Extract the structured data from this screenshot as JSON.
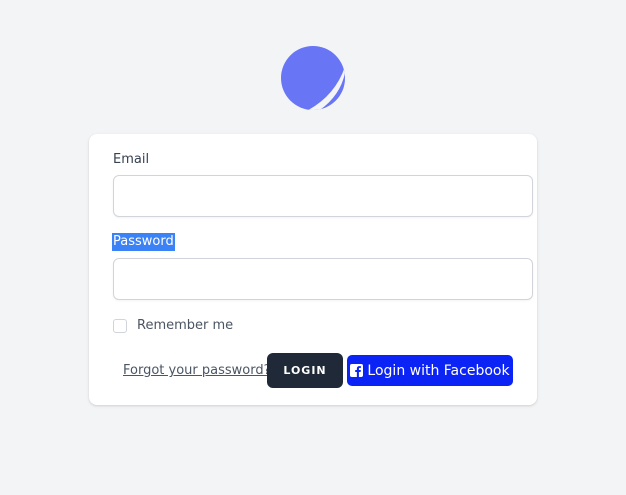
{
  "logo": {
    "icon": "app-logo-icon",
    "color": "#6875f5"
  },
  "form": {
    "email_label": "Email",
    "email_value": "",
    "password_label": "Password",
    "password_value": "",
    "remember_label": "Remember me",
    "remember_checked": false,
    "forgot_label": "Forgot your password?",
    "login_label": "LOGIN",
    "facebook_label": "Login with Facebook",
    "facebook_icon": "facebook-square-icon"
  },
  "colors": {
    "background": "#f3f4f6",
    "login_button": "#1f2937",
    "facebook_button": "#0b24f5",
    "selection_highlight": "#3b82f6"
  }
}
